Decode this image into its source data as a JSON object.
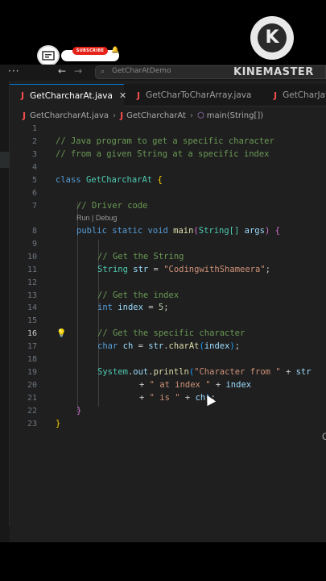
{
  "overlay": {
    "subscribe_label": "SUBSCRIBE",
    "watermark": "KINEMASTER",
    "logo_letter": "K",
    "side_text": "Co"
  },
  "titlebar": {
    "menu_icon": "more-dots-icon",
    "search_placeholder": "GetCharAtDemo"
  },
  "tabs": [
    {
      "label": "GetCharcharAt.java",
      "active": true
    },
    {
      "label": "GetCharToCharArray.java",
      "active": false
    },
    {
      "label": "GetCharJav",
      "active": false
    }
  ],
  "breadcrumb": {
    "file": "GetCharcharAt.java",
    "class": "GetCharcharAt",
    "method": "main(String[])"
  },
  "editor": {
    "codelens": "Run | Debug",
    "active_line": 16,
    "lines": [
      "1",
      "2",
      "3",
      "4",
      "5",
      "6",
      "7",
      "8",
      "9",
      "10",
      "11",
      "12",
      "13",
      "14",
      "15",
      "16",
      "17",
      "18",
      "19",
      "20",
      "21",
      "22",
      "23"
    ],
    "code": {
      "l2": "// Java program to get a specific character",
      "l3": "// from a given String at a specific index",
      "l5_kw": "class",
      "l5_name": "GetCharcharAt",
      "l7": "// Driver code",
      "l8_kw": "public static void",
      "l8_fn": "main",
      "l8_type": "String[]",
      "l8_arg": "args",
      "l10": "// Get the String",
      "l11_type": "String",
      "l11_var": "str",
      "l11_str": "\"CodingwithShameera\"",
      "l13": "// Get the index",
      "l14_type": "int",
      "l14_var": "index",
      "l14_num": "5",
      "l16": "// Get the specific character",
      "l17_type": "char",
      "l17_var": "ch",
      "l17_str": "str",
      "l17_fn": "charAt",
      "l17_arg": "index",
      "l19_sys": "System",
      "l19_out": "out",
      "l19_fn": "println",
      "l19_str": "\"Character from \"",
      "l19_tail": "str",
      "l20_str": "\" at index \"",
      "l20_var": "index",
      "l21_str": "\" is \"",
      "l21_var": "ch"
    }
  },
  "colors": {
    "accent": "#0078d4",
    "editor_bg": "#1f1f1f",
    "comment": "#6a9955",
    "keyword": "#569cd6"
  }
}
